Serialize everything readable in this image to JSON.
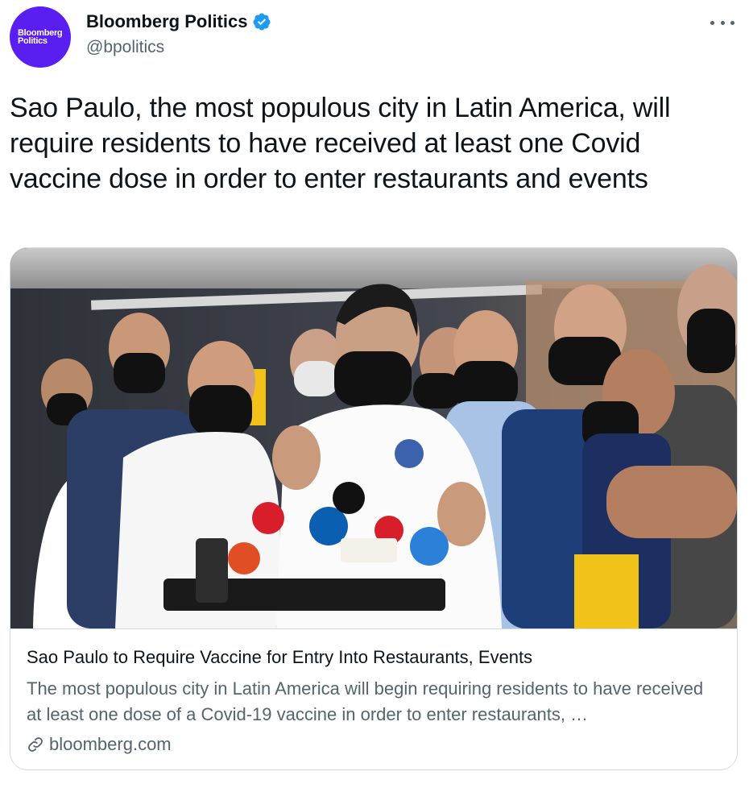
{
  "author": {
    "avatar_text_line1": "Bloomberg",
    "avatar_text_line2": "Politics",
    "display_name": "Bloomberg Politics",
    "handle": "@bpolitics",
    "verified": true,
    "avatar_color": "#5b1ef0",
    "verified_color": "#1d9bf0"
  },
  "tweet": {
    "text": "Sao Paulo, the most populous city in Latin America, will require residents to have received at least one Covid vaccine dose in order to enter restaurants and events"
  },
  "card": {
    "image_icon": "press-conference-photo",
    "title": "Sao Paulo to Require Vaccine for Entry Into Restaurants, Events",
    "description": "The most populous city in Latin America will begin requiring residents to have received at least one dose of a Covid-19 vaccine in order to enter restaurants, …",
    "domain": "bloomberg.com",
    "domain_icon": "link-icon"
  },
  "menu": {
    "icon": "more-icon"
  }
}
